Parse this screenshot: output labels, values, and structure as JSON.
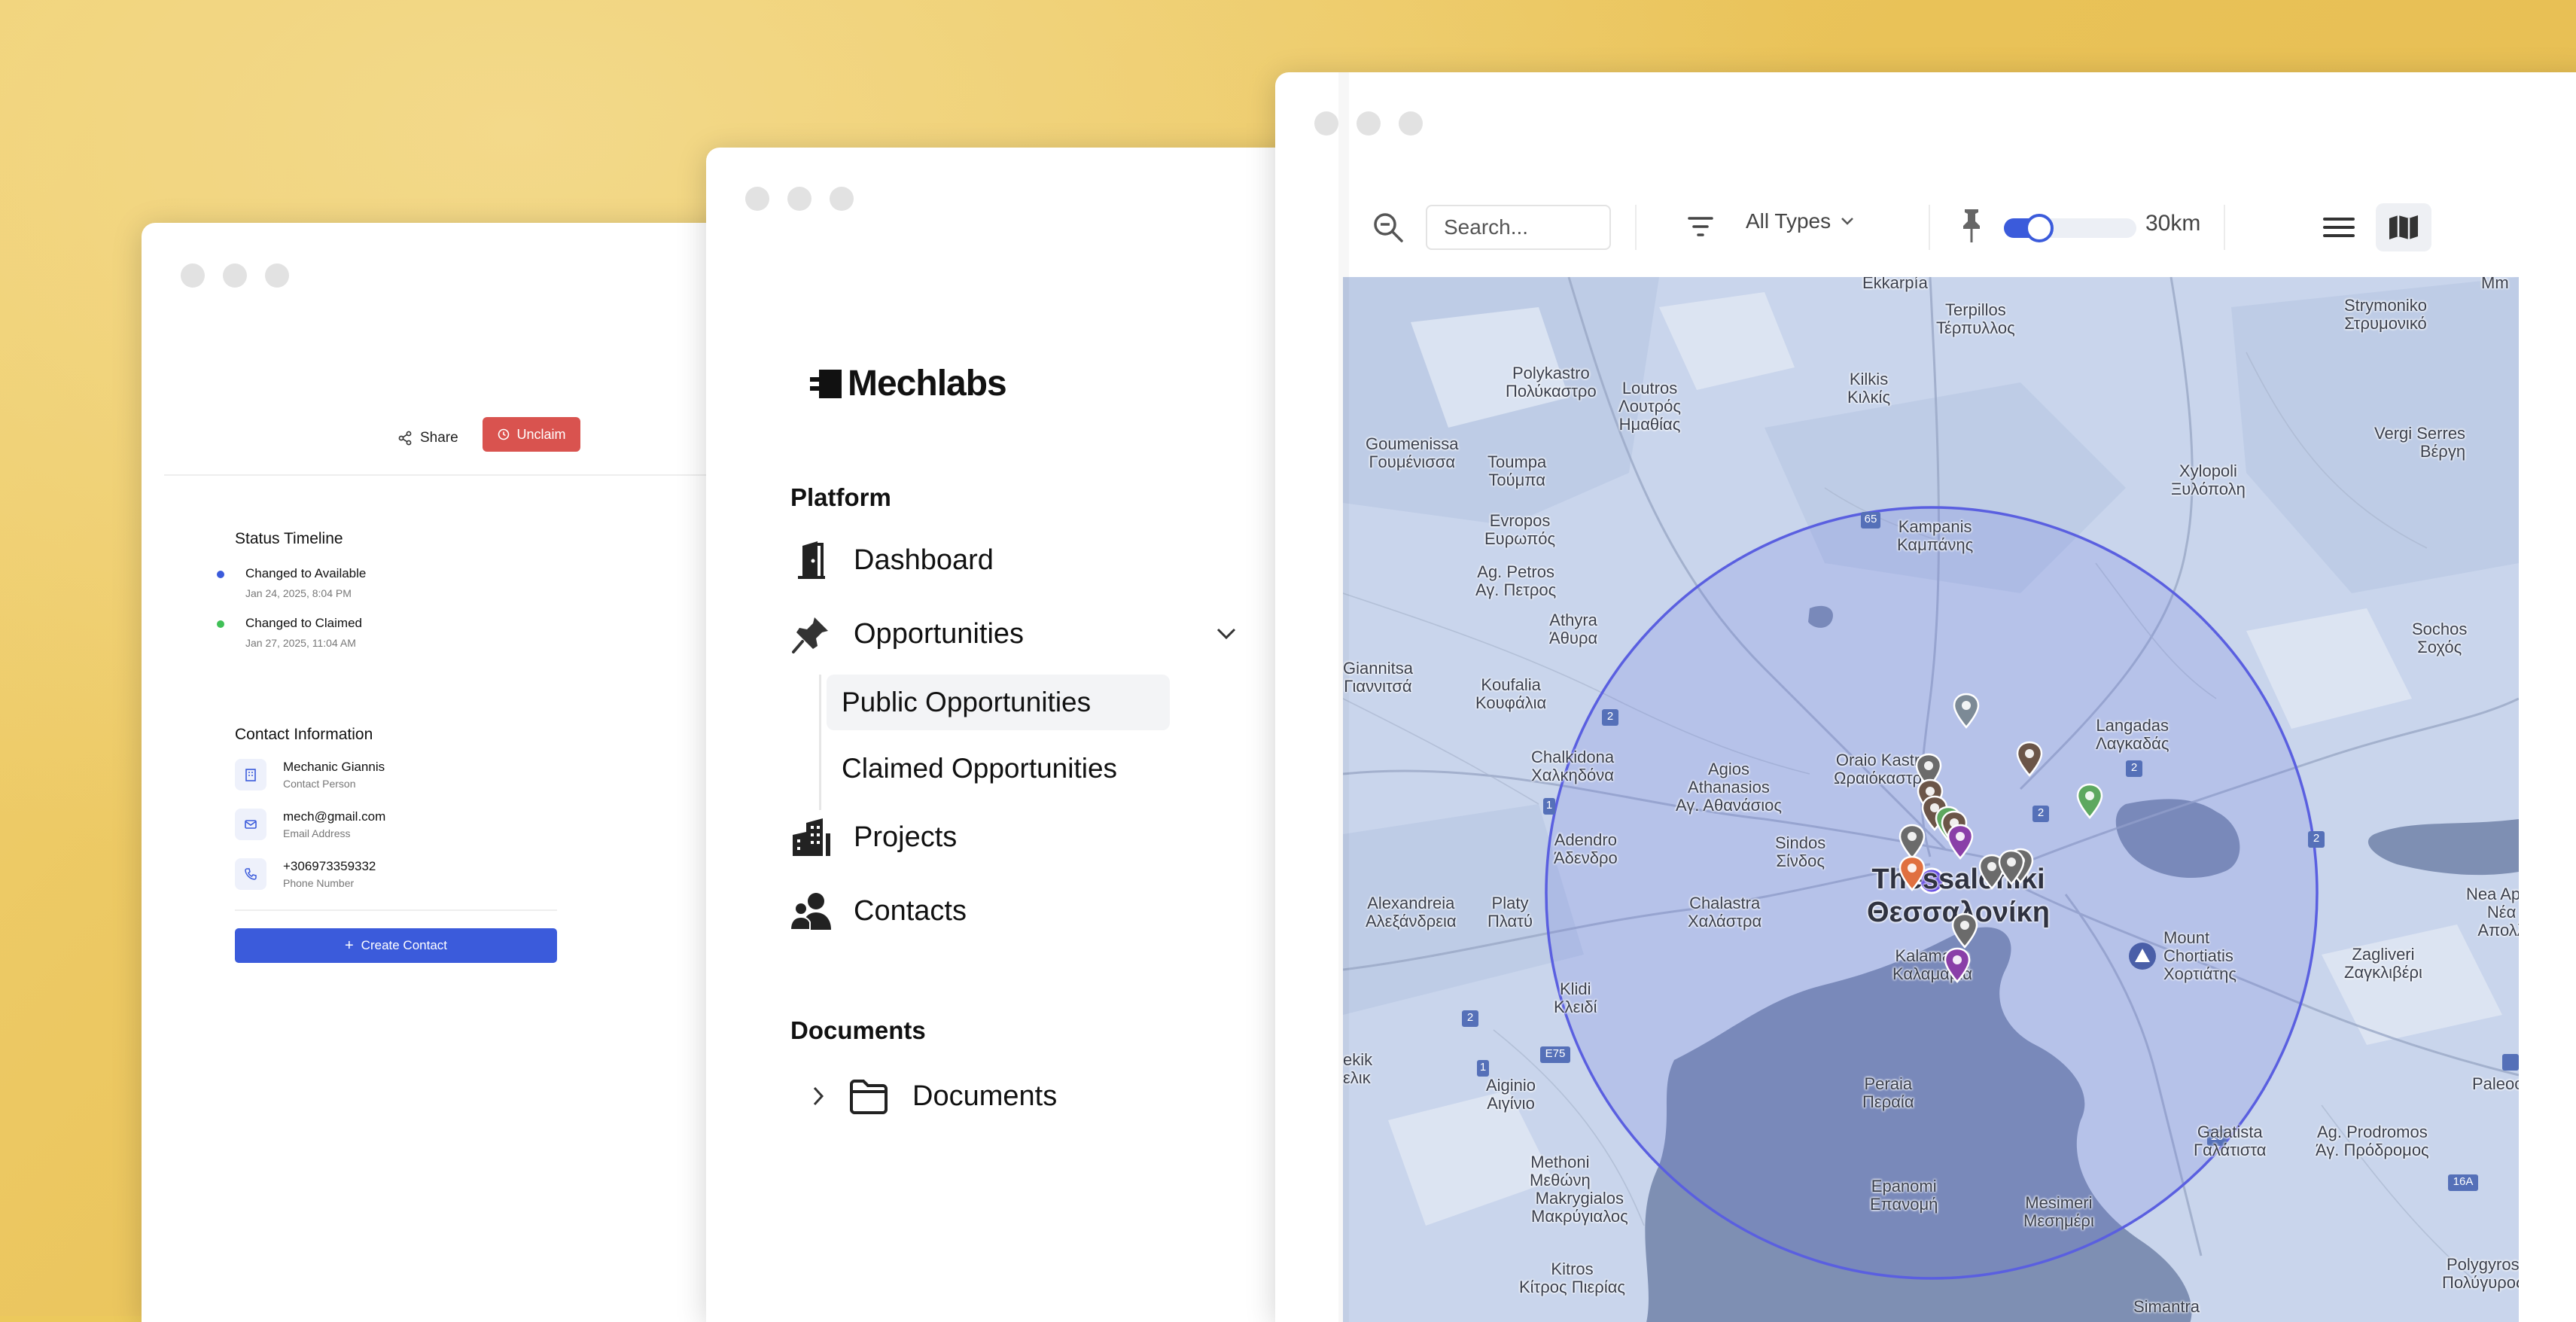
{
  "window_contact": {
    "share_label": "Share",
    "unclaim_label": "Unclaim",
    "status_title": "Status Timeline",
    "timeline": [
      {
        "title": "Changed to Available",
        "date": "Jan 24, 2025, 8:04 PM",
        "color": "#3b5bdb"
      },
      {
        "title": "Changed to Claimed",
        "date": "Jan 27, 2025, 11:04 AM",
        "color": "#40c057"
      }
    ],
    "contact_title": "Contact Information",
    "contacts": [
      {
        "value": "Mechanic Giannis",
        "label": "Contact Person",
        "icon": "building-icon"
      },
      {
        "value": "mech@gmail.com",
        "label": "Email Address",
        "icon": "mail-icon"
      },
      {
        "value": "+306973359332",
        "label": "Phone Number",
        "icon": "phone-icon"
      }
    ],
    "create_label": "Create Contact"
  },
  "sidebar": {
    "brand": "Mechlabs",
    "platform_header": "Platform",
    "items": [
      {
        "label": "Dashboard",
        "icon": "door-icon"
      },
      {
        "label": "Opportunities",
        "icon": "pin-icon"
      },
      {
        "label": "Projects",
        "icon": "buildings-icon"
      },
      {
        "label": "Contacts",
        "icon": "users-icon"
      }
    ],
    "sub_items": [
      {
        "label": "Public Opportunities",
        "active": true
      },
      {
        "label": "Claimed Opportunities",
        "active": false
      }
    ],
    "documents_header": "Documents",
    "documents_item": "Documents"
  },
  "map_window": {
    "search_placeholder": "Search...",
    "type_filter": "All Types",
    "radius_label": "30km",
    "radius_fraction": 0.16,
    "accent": "#3b5bdb",
    "places": [
      {
        "name": "Ekkarpia",
        "text": "Ekkarpía"
      },
      {
        "text": "Terpillos\nΤέρπυλλος"
      },
      {
        "text": "Strymoniko\nΣτρυμονικό"
      },
      {
        "text": "Polykastro\nΠολύκαστρο"
      },
      {
        "text": "Loutros\nΛουτρός\nΗμαθίας"
      },
      {
        "text": "Kilkis\nΚιλκίς"
      },
      {
        "text": "Goumenissa\nΓουμένισσα"
      },
      {
        "text": "Toumpa\nΤούμπα"
      },
      {
        "text": "Xylopoli\nΞυλόπολη"
      },
      {
        "text": "Vergi Serres\nΒέργη"
      },
      {
        "text": "Evropos\nΕυρωπός"
      },
      {
        "text": "Ag. Petros\nΑγ. Πετρος"
      },
      {
        "text": "Kampanis\nΚαμπάνης"
      },
      {
        "text": "Athyra\nΆθυρα"
      },
      {
        "text": "Giannitsa\nΓιαννιτσά"
      },
      {
        "text": "Koufalia\nΚουφάλια"
      },
      {
        "text": "Sochos\nΣοχός"
      },
      {
        "text": "Langadas\nΛαγκαδάς"
      },
      {
        "text": "Oraio Kastro\nΩραιόκαστρο"
      },
      {
        "text": "Chalkidona\nΧαλκηδόνα"
      },
      {
        "text": "Agios\nAthanasios\nΑγ. Αθανάσιος"
      },
      {
        "text": "Adendro\nΆδενδρο"
      },
      {
        "text": "Sindos\nΣίνδος"
      },
      {
        "text": "Thessaloniki\nΘεσσαλονίκη"
      },
      {
        "text": "Nea Apoll\nΝέα\nΑπολλ"
      },
      {
        "text": "Alexandreia\nΑλεξάνδρεια"
      },
      {
        "text": "Platy\nΠλατύ"
      },
      {
        "text": "Chalastra\nΧαλάστρα"
      },
      {
        "text": "Mount\nChortiatis\nΧορτιάτης"
      },
      {
        "text": "Kalamaria\nΚαλαμαριά"
      },
      {
        "text": "Zagliveri\nΖαγκλιβέρι"
      },
      {
        "text": "Klidi\nΚλειδί"
      },
      {
        "text": "Aiginio\nΑιγίνιο"
      },
      {
        "text": "Peraia\nΠεραία"
      },
      {
        "text": "Paleoc"
      },
      {
        "text": "Galatista\nΓαλάτιστα"
      },
      {
        "text": "Ag. Prodromos\nΆγ. Πρόδρομος"
      },
      {
        "text": "Methoni\nΜεθώνη"
      },
      {
        "text": "Makrygialos\nΜακρύγιαλος"
      },
      {
        "text": "Epanomi\nΕπανομή"
      },
      {
        "text": "Mesimeri\nΜεσημέρι"
      },
      {
        "text": "Kitros\nΚίτρος Πιερίας"
      },
      {
        "text": "Simantra"
      },
      {
        "text": "Polygyros\nΠολύγυρος"
      },
      {
        "text": "Mm"
      },
      {
        "text": "ekik\nελικ"
      }
    ],
    "road_labels": [
      "65",
      "2",
      "2",
      "2",
      "2",
      "2",
      "E75",
      "1",
      "1",
      "16",
      "16A"
    ]
  }
}
